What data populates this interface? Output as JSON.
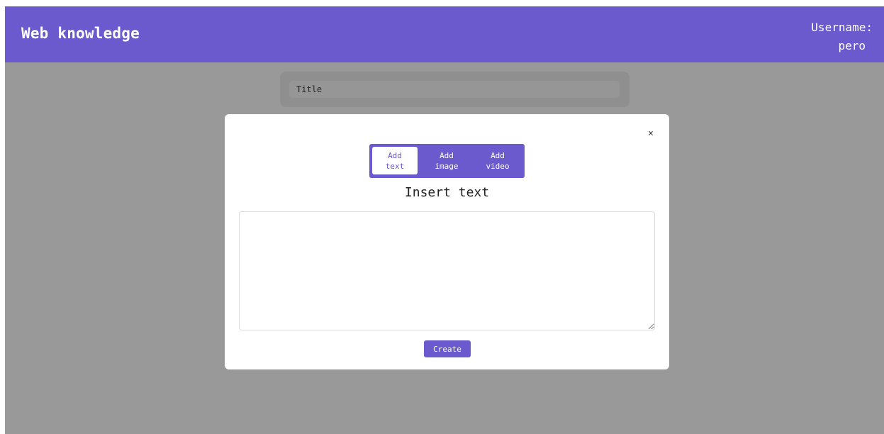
{
  "header": {
    "brand": "Web knowledge",
    "username_label": "Username:",
    "username_value": "pero"
  },
  "form": {
    "title_placeholder": "Title"
  },
  "modal": {
    "close_label": "×",
    "tabs": [
      {
        "line1": "Add",
        "line2": "text",
        "active": true
      },
      {
        "line1": "Add",
        "line2": "image",
        "active": false
      },
      {
        "line1": "Add",
        "line2": "video",
        "active": false
      }
    ],
    "heading": "Insert text",
    "textarea_value": "",
    "create_label": "Create"
  },
  "colors": {
    "accent": "#6a5acd",
    "overlay": "rgba(0,0,0,0.4)"
  }
}
